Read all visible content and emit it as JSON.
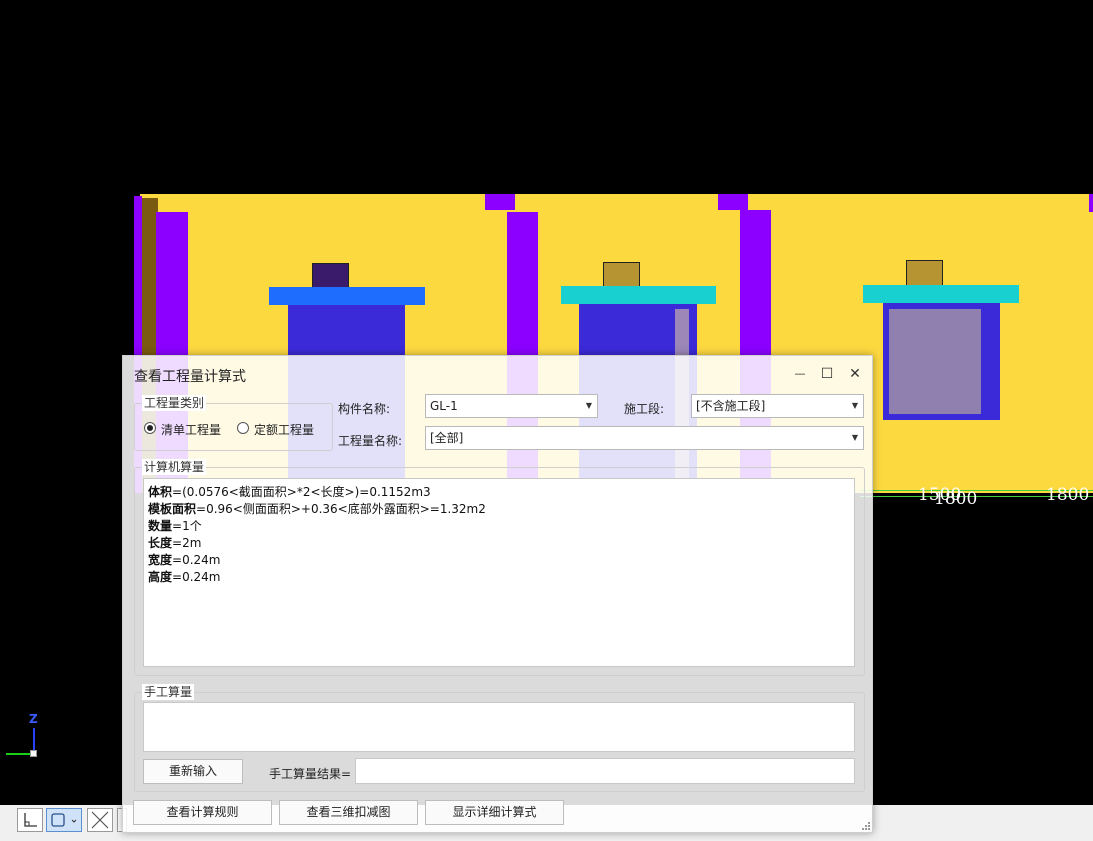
{
  "viewport": {
    "dimension_labels": [
      "1500",
      "1800",
      "1800"
    ],
    "axis": {
      "z_label": "Z"
    }
  },
  "dialog": {
    "title": "查看工程量计算式",
    "window_controls": {
      "minimize": "—",
      "maximize": "☐",
      "close": "✕"
    },
    "category_group": {
      "legend": "工程量类别",
      "options": [
        {
          "label": "清单工程量",
          "selected": true
        },
        {
          "label": "定额工程量",
          "selected": false
        }
      ]
    },
    "component_name": {
      "label": "构件名称:",
      "value": "GL-1"
    },
    "construction_stage": {
      "label": "施工段:",
      "value": "[不含施工段]"
    },
    "quantity_name": {
      "label": "工程量名称:",
      "value": "[全部]"
    },
    "computer_calc": {
      "legend": "计算机算量",
      "lines": [
        {
          "name": "体积",
          "expr": "=(0.0576<截面面积>*2<长度>)=0.1152m3"
        },
        {
          "name": "模板面积",
          "expr": "=0.96<侧面面积>+0.36<底部外露面积>=1.32m2"
        },
        {
          "name": "数量",
          "expr": "=1个"
        },
        {
          "name": "长度",
          "expr": "=2m"
        },
        {
          "name": "宽度",
          "expr": "=0.24m"
        },
        {
          "name": "高度",
          "expr": "=0.24m"
        }
      ]
    },
    "manual_calc": {
      "legend": "手工算量",
      "reenter_button": "重新输入",
      "result_label": "手工算量结果=",
      "result_value": ""
    },
    "buttons": {
      "view_rules": "查看计算规则",
      "view_3d": "查看三维扣减图",
      "show_detail": "显示详细计算式"
    }
  }
}
